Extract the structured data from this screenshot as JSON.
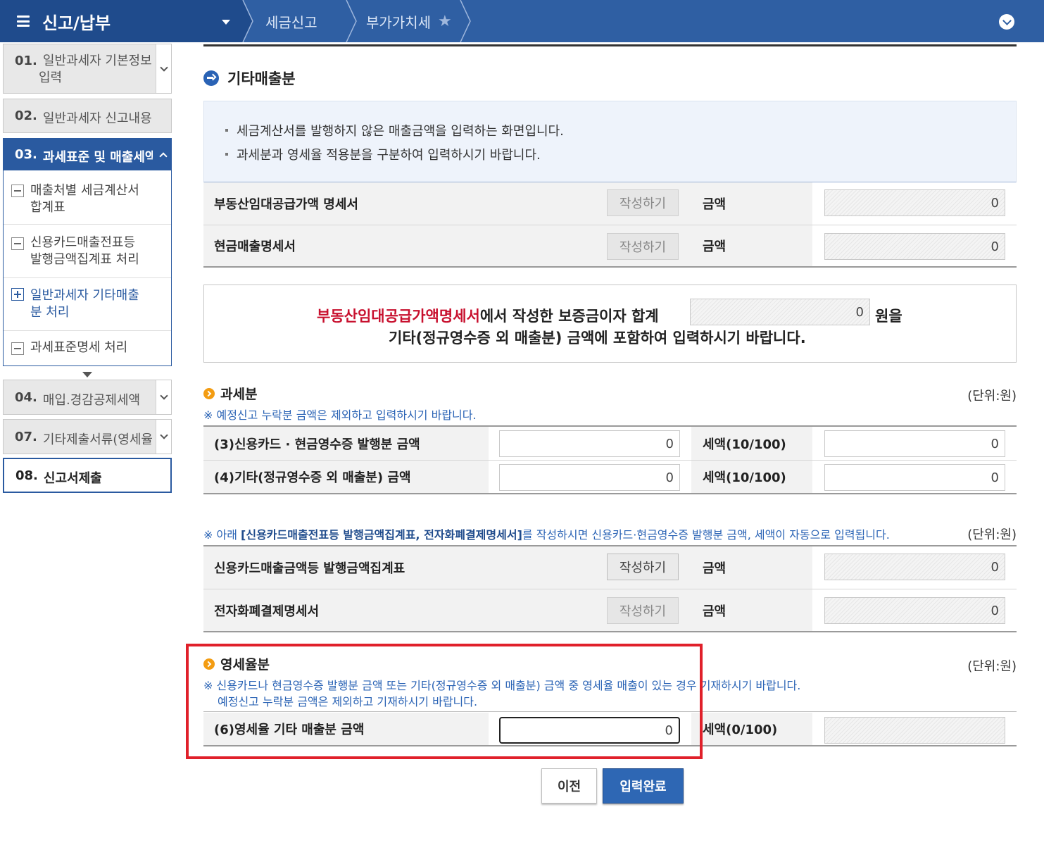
{
  "topbar": {
    "title": "신고/납부",
    "breadcrumb_1": "세금신고",
    "breadcrumb_2": "부가가치세"
  },
  "sidebar": {
    "steps": [
      {
        "num": "01.",
        "label": "일반과세자 기본정보",
        "label2": "입력"
      },
      {
        "num": "02.",
        "label": "일반과세자 신고내용"
      },
      {
        "num": "03.",
        "label": "과세표준 및 매출세액"
      },
      {
        "num": "04.",
        "label": "매입.경감공제세액"
      },
      {
        "num": "07.",
        "label": "기타제출서류(영세율"
      },
      {
        "num": "08.",
        "label": "신고서제출"
      }
    ],
    "substeps": [
      {
        "line1": "매출처별 세금계산서",
        "line2": "합계표"
      },
      {
        "line1": "신용카드매출전표등",
        "line2": "발행금액집계표 처리"
      },
      {
        "line1": "일반과세자 기타매출",
        "line2": "분 처리"
      },
      {
        "line1": "과세표준명세 처리"
      }
    ]
  },
  "main": {
    "section_title": "기타매출분",
    "info_lines": [
      "세금계산서를 발행하지 않은 매출금액을 입력하는 화면입니다.",
      "과세분과 영세율 적용분을 구분하여 입력하시기 바랍니다."
    ],
    "write_label": "작성하기",
    "amount_label": "금액",
    "unit_label": "(단위:원)",
    "top_rows": [
      {
        "label": "부동산임대공급가액 명세서",
        "amount": "0"
      },
      {
        "label": "현금매출명세서",
        "amount": "0"
      }
    ],
    "notice": {
      "red_part": "부동산임대공급가액명세서",
      "rest_part": "에서 작성한 보증금이자 합계",
      "value": "0",
      "won": "원을",
      "line2": "기타(정규영수증 외 매출분) 금액에 포함하여 입력하시기 바랍니다."
    },
    "taxable": {
      "title": "과세분",
      "note": "※ 예정신고 누락분 금액은 제외하고 입력하시기 바랍니다.",
      "rows": [
        {
          "label": "(3)신용카드 · 현금영수증 발행분 금액",
          "value": "0",
          "tax_label": "세액(10/100)",
          "tax_value": "0"
        },
        {
          "label": "(4)기타(정규영수증 외 매출분) 금액",
          "value": "0",
          "tax_label": "세액(10/100)",
          "tax_value": "0"
        }
      ]
    },
    "auto_note": {
      "prefix": "※ 아래 ",
      "bold": "[신용카드매출전표등 발행금액집계표, 전자화폐결제명세서]",
      "suffix": "를 작성하시면 신용카드·현금영수증 발행분 금액, 세액이 자동으로 입력됩니다."
    },
    "auto_rows": [
      {
        "label": "신용카드매출금액등 발행금액집계표",
        "amount": "0"
      },
      {
        "label": "전자화폐결제명세서",
        "amount": "0"
      }
    ],
    "zero_rated": {
      "title": "영세율분",
      "note1": "※ 신용카드나 현금영수증 발행분 금액 또는 기타(정규영수증 외 매출분) 금액 중 영세율 매출이 있는 경우 기재하시기 바랍니다.",
      "note2": "예정신고 누락분 금액은 제외하고 기재하시기 바랍니다.",
      "row_label": "(6)영세율 기타 매출분 금액",
      "value": "0",
      "tax_label": "세액(0/100)"
    },
    "buttons": {
      "prev": "이전",
      "done": "입력완료"
    }
  }
}
